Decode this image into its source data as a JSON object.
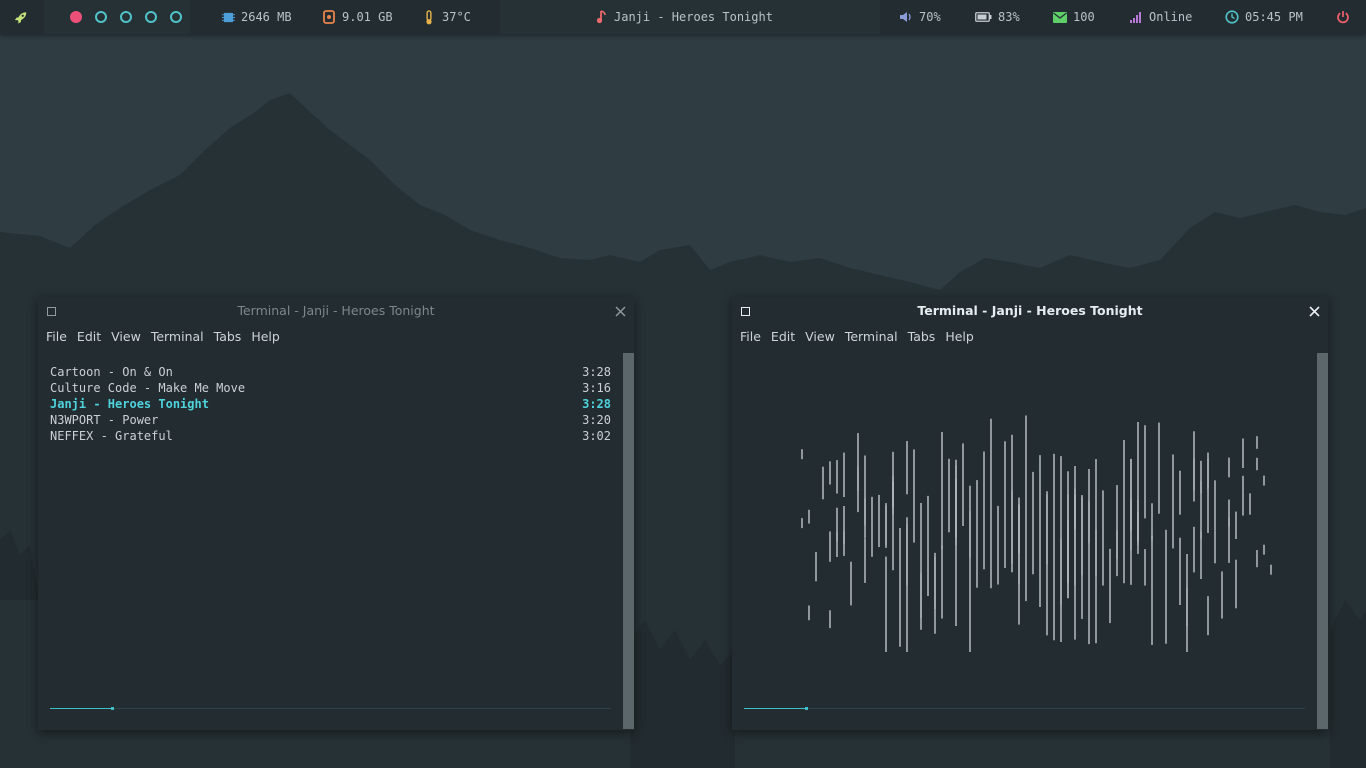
{
  "topbar": {
    "launcher_icon": "rocket-icon",
    "workspaces": [
      {
        "id": 1,
        "active": true
      },
      {
        "id": 2,
        "active": false
      },
      {
        "id": 3,
        "active": false
      },
      {
        "id": 4,
        "active": false
      },
      {
        "id": 5,
        "active": false
      }
    ],
    "memory": "2646 MB",
    "disk": "9.01 GB",
    "temperature": "37°C",
    "now_playing": "Janji - Heroes Tonight",
    "volume": "70%",
    "battery": "83%",
    "mail": "100",
    "network": "Online",
    "clock": "05:45 PM",
    "power_icon": "power-icon"
  },
  "colors": {
    "accent_cyan": "#4ed2dc",
    "workspace_active": "#ec4f78",
    "memory": "#4c9fd8",
    "disk": "#e9844a",
    "temperature": "#e6b34a",
    "music": "#ee6b6b",
    "volume": "#8a9bd8",
    "mail": "#5fcf6a",
    "network": "#b878d8",
    "clock": "#4fc3c8",
    "power": "#ef5f6b"
  },
  "terminal_left": {
    "title": "Terminal - Janji - Heroes Tonight",
    "menu": [
      "File",
      "Edit",
      "View",
      "Terminal",
      "Tabs",
      "Help"
    ],
    "playlist": [
      {
        "track": "Cartoon - On & On",
        "duration": "3:28",
        "current": false
      },
      {
        "track": "Culture Code - Make Me Move",
        "duration": "3:16",
        "current": false
      },
      {
        "track": "Janji - Heroes Tonight",
        "duration": "3:28",
        "current": true
      },
      {
        "track": "N3WPORT - Power",
        "duration": "3:20",
        "current": false
      },
      {
        "track": "NEFFEX - Grateful",
        "duration": "3:02",
        "current": false
      }
    ],
    "progress": 0.11
  },
  "terminal_right": {
    "title": "Terminal - Janji - Heroes Tonight",
    "menu": [
      "File",
      "Edit",
      "View",
      "Terminal",
      "Tabs",
      "Help"
    ],
    "progress": 0.11
  }
}
